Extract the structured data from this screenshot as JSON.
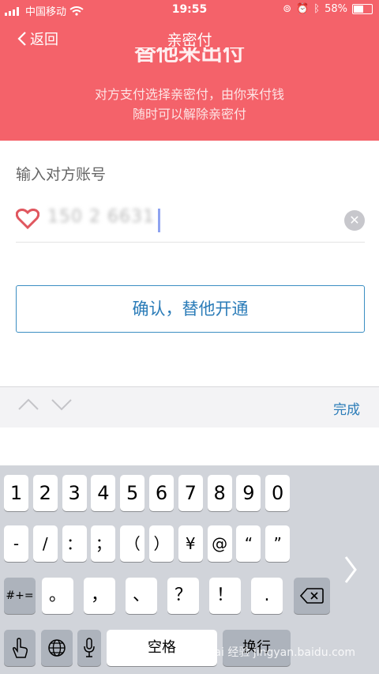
{
  "status_bar": {
    "carrier": "中国移动",
    "time": "19:55",
    "battery_percent": "58%",
    "battery_level": 0.58
  },
  "nav": {
    "back_label": "返回",
    "title": "亲密付"
  },
  "hero": {
    "clipped_heading": "替他来出付",
    "line1": "对方支付选择亲密付，由你来付钱",
    "line2": "随时可以解除亲密付"
  },
  "form": {
    "label": "输入对方账号",
    "account_value": "150 2  6631",
    "confirm_label": "确认，替他开通"
  },
  "accessory": {
    "done_label": "完成"
  },
  "keyboard": {
    "row1": [
      "1",
      "2",
      "3",
      "4",
      "5",
      "6",
      "7",
      "8",
      "9",
      "0"
    ],
    "row2": [
      "-",
      "/",
      "：",
      "；",
      "（",
      "）",
      "¥",
      "@",
      "“",
      "”"
    ],
    "row3_special": "#+=",
    "row3": [
      "。",
      "，",
      "、",
      "？",
      "！",
      "."
    ],
    "space_label": "空格",
    "return_label": "换行"
  },
  "watermark": "Bai 经验 jingyan.baidu.com",
  "colors": {
    "header_bg": "#f4626a",
    "accent": "#2b7cb8",
    "keyboard_bg": "#d1d4da"
  }
}
